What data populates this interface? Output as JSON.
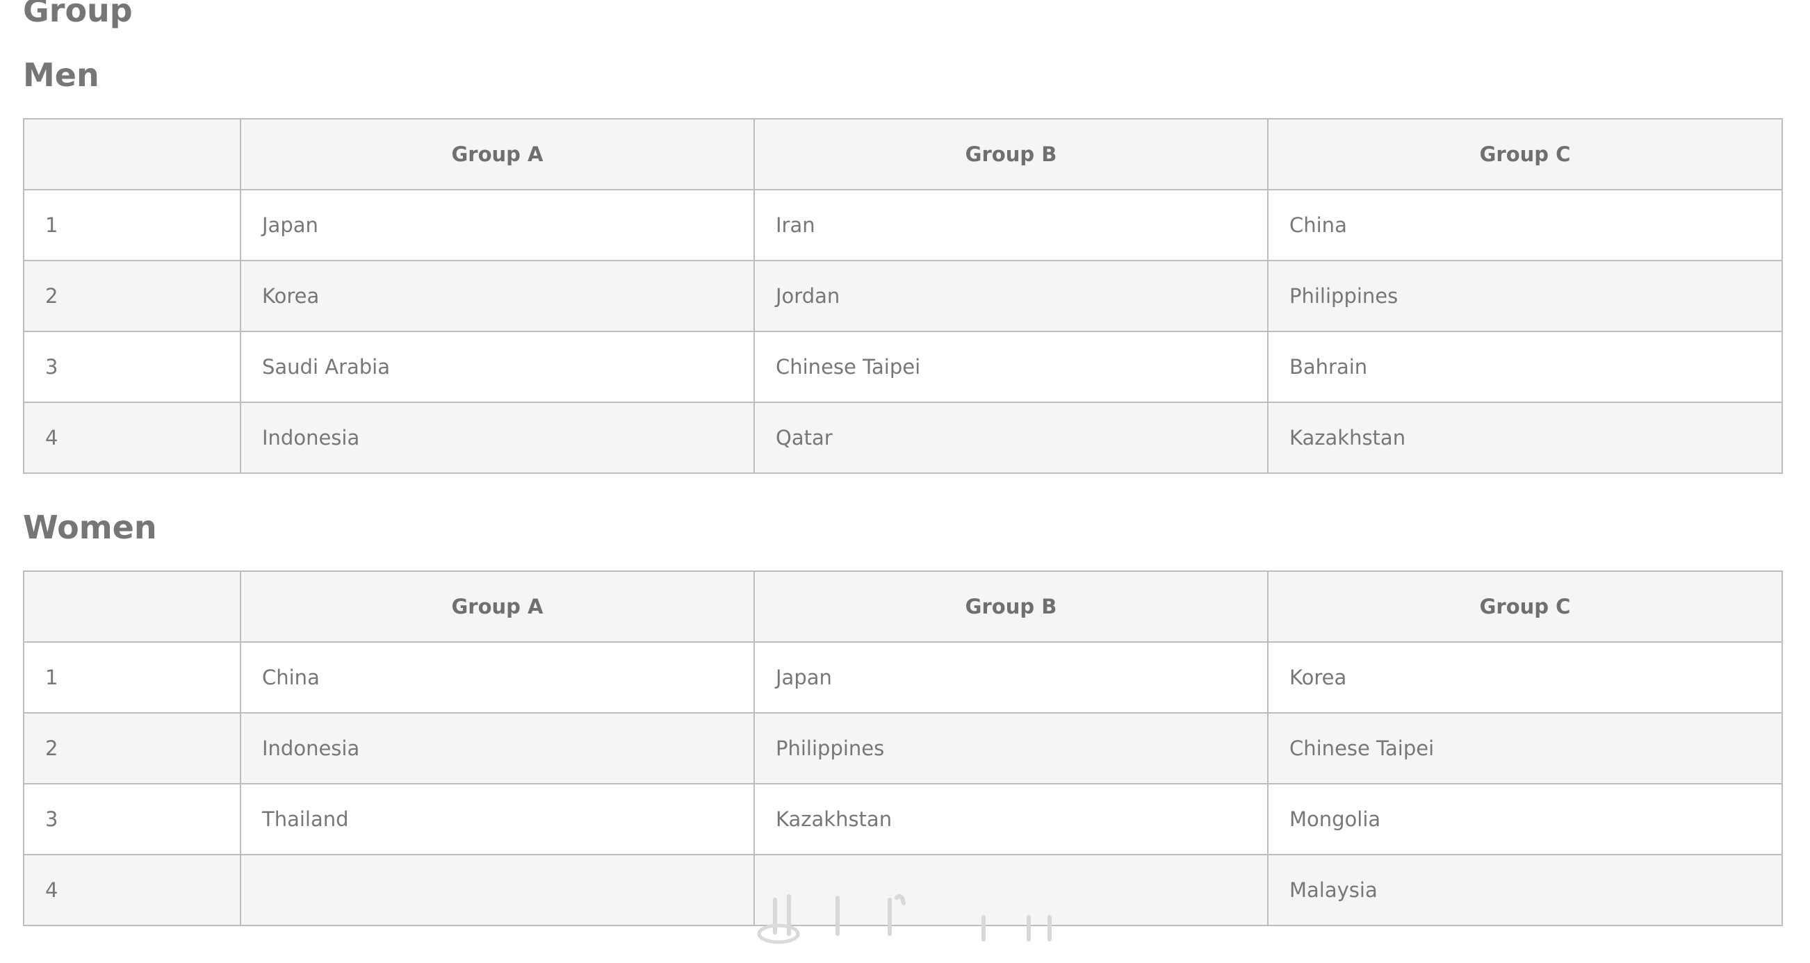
{
  "page": {
    "title": "Group",
    "men": {
      "heading": "Men",
      "columns": [
        "",
        "Group A",
        "Group B",
        "Group C"
      ],
      "rows": [
        {
          "rank": "1",
          "a": "Japan",
          "b": "Iran",
          "c": "China"
        },
        {
          "rank": "2",
          "a": "Korea",
          "b": "Jordan",
          "c": "Philippines"
        },
        {
          "rank": "3",
          "a": "Saudi Arabia",
          "b": "Chinese Taipei",
          "c": "Bahrain"
        },
        {
          "rank": "4",
          "a": "Indonesia",
          "b": "Qatar",
          "c": "Kazakhstan"
        }
      ]
    },
    "women": {
      "heading": "Women",
      "columns": [
        "",
        "Group A",
        "Group B",
        "Group C"
      ],
      "rows": [
        {
          "rank": "1",
          "a": "China",
          "b": "Japan",
          "c": "Korea"
        },
        {
          "rank": "2",
          "a": "Indonesia",
          "b": "Philippines",
          "c": "Chinese Taipei"
        },
        {
          "rank": "3",
          "a": "Thailand",
          "b": "Kazakhstan",
          "c": "Mongolia"
        },
        {
          "rank": "4",
          "a": "",
          "b": "",
          "c": "Malaysia"
        }
      ]
    }
  },
  "colors": {
    "text": "#777777",
    "border": "#bdbdbd",
    "stripe": "#f5f5f5",
    "background": "#ffffff"
  }
}
